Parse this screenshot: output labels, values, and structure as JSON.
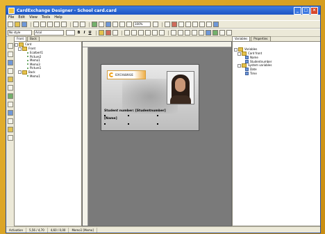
{
  "window": {
    "title": "CardExchange Designer - School card.card"
  },
  "menu": [
    "File",
    "Edit",
    "View",
    "Tools",
    "Help"
  ],
  "toolbar2": {
    "font_combo": "No style",
    "font_name": "Arial",
    "bold": "B",
    "italic": "I",
    "underline": "U"
  },
  "toolbar1": {
    "zoom": "100%"
  },
  "left_tabs": {
    "front": "Front",
    "back": "Back"
  },
  "tree": {
    "root": "Card",
    "front": "Front",
    "front_items": [
      "Ecalbert1",
      "Picture2",
      "Memo1",
      "Memo3",
      "Picture1"
    ],
    "back": "Back",
    "back_items": [
      "Memo1"
    ]
  },
  "card": {
    "logo_text": "EXCHANGE",
    "student_label": "Student number: [Studentnumber]",
    "name_field": "[Name]"
  },
  "right_tabs": {
    "variables": "Variables",
    "properties": "Properties"
  },
  "variables": {
    "root": "Variables",
    "card_front": "Card front",
    "card_front_items": [
      "Name",
      "Studentnumber"
    ],
    "system_vars": "System variables",
    "system_items": [
      "Date",
      "Time"
    ]
  },
  "status": {
    "mode": "Activation",
    "pos": "5,56 / 4,70",
    "size": "4,60 / 0,00",
    "selected": "Memo1 [Memo]"
  },
  "colors": {
    "accent": "#1d55c4",
    "frame": "#d9a21a",
    "canvas": "#7a7a7a"
  }
}
